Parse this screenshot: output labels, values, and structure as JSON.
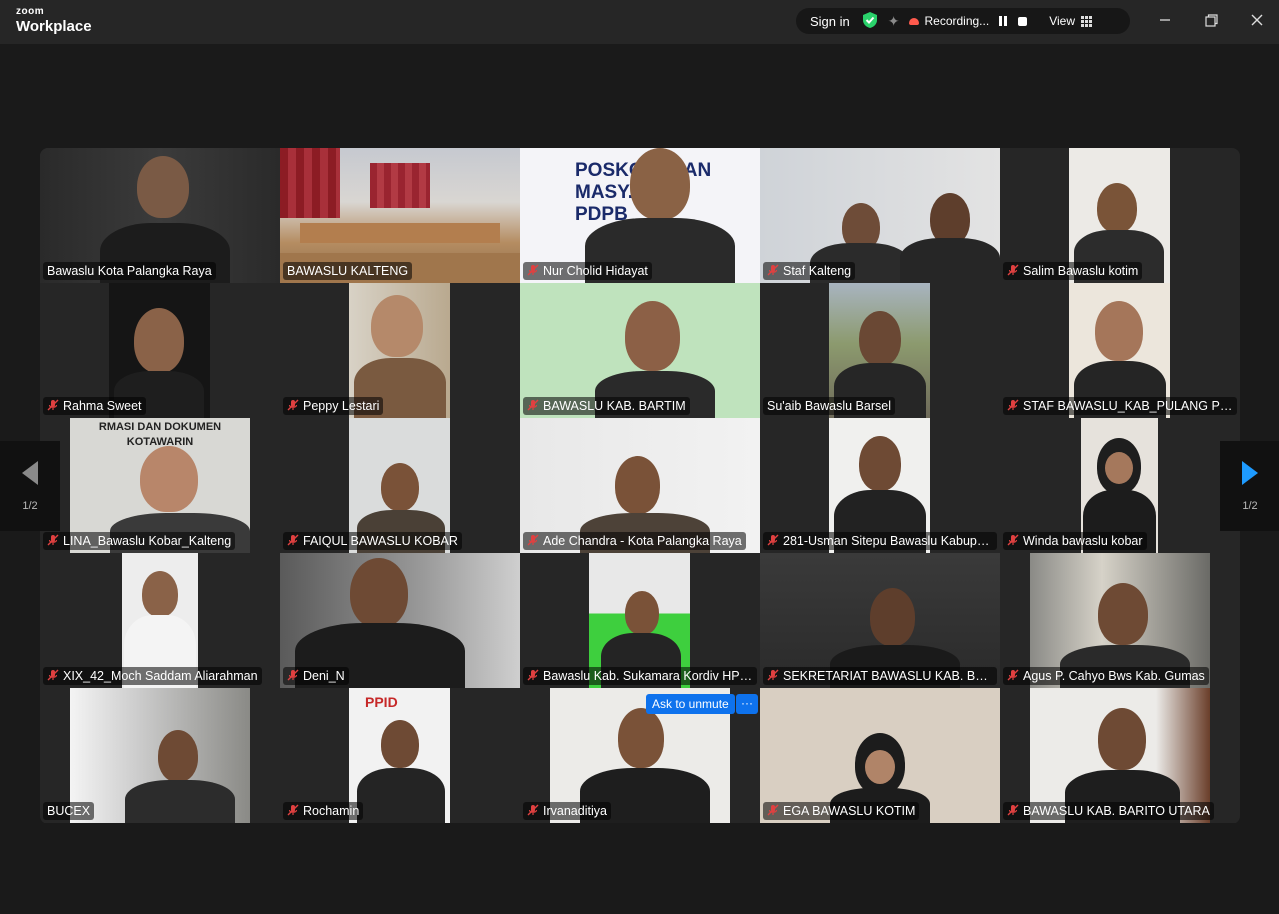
{
  "app": {
    "brand_top": "zoom",
    "brand_name": "Workplace"
  },
  "toolbar": {
    "sign_in": "Sign in",
    "recording_label": "Recording...",
    "view_label": "View",
    "shield_color": "#2ad26b",
    "recording_color": "#ff5a4d"
  },
  "window_controls": {
    "minimize": "minimize-icon",
    "restore": "restore-icon",
    "close": "close-icon"
  },
  "pagination": {
    "left_page": "1/2",
    "right_page": "1/2",
    "active_arrow_color": "#1e9bff"
  },
  "participants": [
    {
      "name": "Bawaslu Kota Palangka Raya",
      "muted": false
    },
    {
      "name": "BAWASLU KALTENG",
      "muted": false,
      "active_speaker": true
    },
    {
      "name": "Nur Cholid Hidayat",
      "muted": true
    },
    {
      "name": "Staf Kalteng",
      "muted": true
    },
    {
      "name": "Salim Bawaslu kotim",
      "muted": true
    },
    {
      "name": "Rahma Sweet",
      "muted": true
    },
    {
      "name": "Peppy Lestari",
      "muted": true
    },
    {
      "name": "BAWASLU KAB. BARTIM",
      "muted": true
    },
    {
      "name": "Su'aib Bawaslu Barsel",
      "muted": false
    },
    {
      "name": "STAF BAWASLU_KAB_PULANG PISAU",
      "muted": true
    },
    {
      "name": "LINA_Bawaslu Kobar_Kalteng",
      "muted": true
    },
    {
      "name": "FAIQUL BAWASLU KOBAR",
      "muted": true
    },
    {
      "name": "Ade Chandra - Kota Palangka Raya",
      "muted": true
    },
    {
      "name": "281-Usman Sitepu Bawaslu Kabupa...",
      "muted": true
    },
    {
      "name": "Winda bawaslu kobar",
      "muted": true
    },
    {
      "name": "XIX_42_Moch Saddam Aliarahman",
      "muted": true
    },
    {
      "name": "Deni_N",
      "muted": true
    },
    {
      "name": "Bawaslu Kab. Sukamara Kordiv HP2...",
      "muted": true
    },
    {
      "name": "SEKRETARIAT BAWASLU KAB. BARIT...",
      "muted": true
    },
    {
      "name": "Agus P. Cahyo Bws Kab. Gumas",
      "muted": true
    },
    {
      "name": "BUCEX",
      "muted": false
    },
    {
      "name": "Rochamin",
      "muted": true
    },
    {
      "name": "Irvanaditiya",
      "muted": true
    },
    {
      "name": "EGA BAWASLU KOTIM",
      "muted": true
    },
    {
      "name": "BAWASLU KAB. BARITO UTARA",
      "muted": true
    }
  ],
  "hover_actions": {
    "ask_to_unmute": "Ask to unmute",
    "more": "···"
  },
  "slide_text": {
    "line1": "POSKO ... UAN",
    "line2": "MASY... AT",
    "line3": "PDPB"
  },
  "banner_text": {
    "line1": "RMASI DAN DOKUMEN",
    "line2": "KOTAWARIN"
  },
  "poster_text": "PPID"
}
